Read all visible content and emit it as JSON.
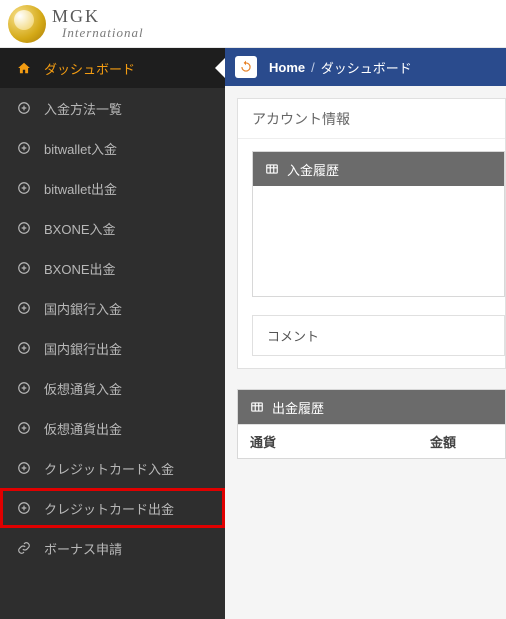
{
  "brand": {
    "top": "MGK",
    "bottom": "International"
  },
  "breadcrumb": {
    "home": "Home",
    "current": "ダッシュボード"
  },
  "sidebar": {
    "items": [
      {
        "label": "ダッシュボード",
        "icon": "home",
        "active": true
      },
      {
        "label": "入金方法一覧",
        "icon": "plus"
      },
      {
        "label": "bitwallet入金",
        "icon": "plus"
      },
      {
        "label": "bitwallet出金",
        "icon": "plus"
      },
      {
        "label": "BXONE入金",
        "icon": "plus"
      },
      {
        "label": "BXONE出金",
        "icon": "plus"
      },
      {
        "label": "国内銀行入金",
        "icon": "plus"
      },
      {
        "label": "国内銀行出金",
        "icon": "plus"
      },
      {
        "label": "仮想通貨入金",
        "icon": "plus"
      },
      {
        "label": "仮想通貨出金",
        "icon": "plus"
      },
      {
        "label": "クレジットカード入金",
        "icon": "plus"
      },
      {
        "label": "クレジットカード出金",
        "icon": "plus",
        "highlighted": true
      },
      {
        "label": "ボーナス申請",
        "icon": "link"
      }
    ]
  },
  "account_panel": {
    "title": "アカウント情報"
  },
  "deposit_card": {
    "title": "入金履歴"
  },
  "comment": {
    "label": "コメント"
  },
  "withdraw_card": {
    "title": "出金履歴",
    "columns": [
      "通貨",
      "金額"
    ]
  }
}
